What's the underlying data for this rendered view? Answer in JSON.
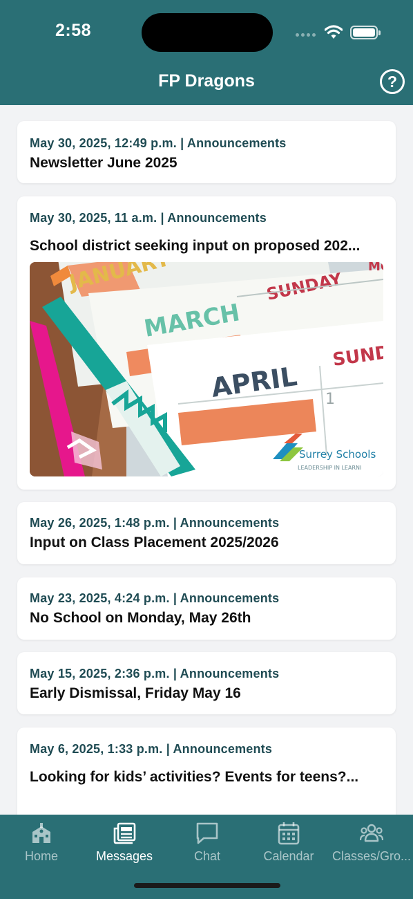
{
  "status_bar": {
    "time": "2:58"
  },
  "header": {
    "title": "FP Dragons",
    "help_icon": "question-circle-icon",
    "help_glyph": "?"
  },
  "posts": [
    {
      "meta": "May 30, 2025, 12:49 p.m. | Announcements",
      "title": "Newsletter June 2025"
    },
    {
      "meta": "May 30, 2025, 11 a.m. | Announcements",
      "title": "School district seeking input on proposed 202...",
      "image": {
        "months": [
          "JANUARY",
          "MARCH",
          "APRIL"
        ],
        "day_labels": [
          "SUNDAY",
          "SUNDAY",
          "MO"
        ],
        "day_number": "1",
        "logo_name": "Surrey Schools",
        "logo_tagline": "LEADERSHIP IN LEARNI"
      }
    },
    {
      "meta": "May 26, 2025, 1:48 p.m. | Announcements",
      "title": "Input on Class Placement 2025/2026"
    },
    {
      "meta": "May 23, 2025, 4:24 p.m. | Announcements",
      "title": "No School on Monday, May 26th"
    },
    {
      "meta": "May 15, 2025, 2:36 p.m. | Announcements",
      "title": "Early  Dismissal, Friday May 16"
    },
    {
      "meta": "May 6, 2025, 1:33 p.m. | Announcements",
      "title": "Looking for kids’ activities? Events for teens?..."
    }
  ],
  "tabs": [
    {
      "label": "Home",
      "icon": "school-icon",
      "active": false
    },
    {
      "label": "Messages",
      "icon": "newspaper-icon",
      "active": true
    },
    {
      "label": "Chat",
      "icon": "chat-bubble-icon",
      "active": false
    },
    {
      "label": "Calendar",
      "icon": "calendar-icon",
      "active": false
    },
    {
      "label": "Classes/Gro...",
      "icon": "group-icon",
      "active": false
    }
  ],
  "colors": {
    "brand": "#2a6f75",
    "meta_text": "#1f4b53",
    "background": "#f2f3f5"
  }
}
